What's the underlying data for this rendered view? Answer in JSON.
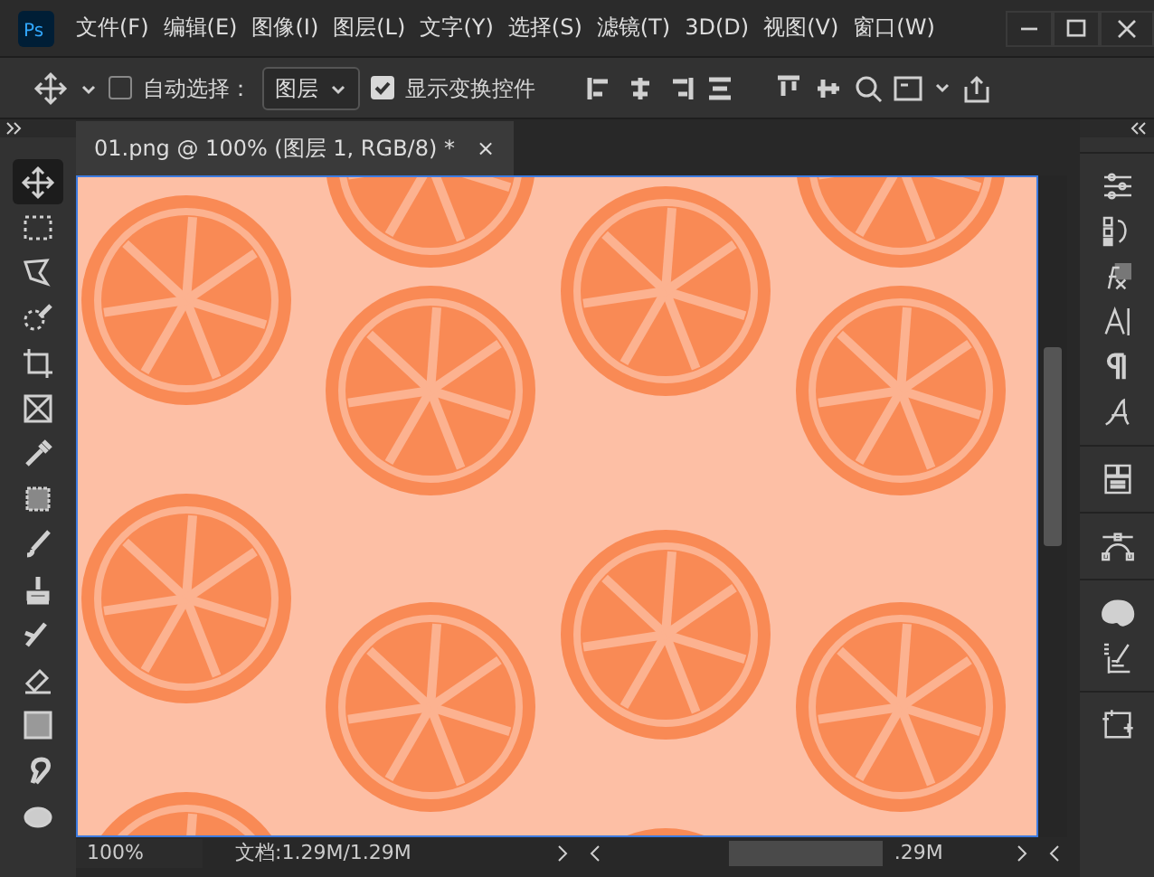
{
  "app_logo": "Ps",
  "menu": [
    "文件(F)",
    "编辑(E)",
    "图像(I)",
    "图层(L)",
    "文字(Y)",
    "选择(S)",
    "滤镜(T)",
    "3D(D)",
    "视图(V)",
    "窗口(W)"
  ],
  "options_bar": {
    "auto_select": {
      "label": "自动选择：",
      "checked": false
    },
    "target": {
      "value": "图层"
    },
    "show_transform": {
      "label": "显示变换控件",
      "checked": true
    }
  },
  "document_tab": {
    "title": "01.png @ 100% (图层 1, RGB/8) *",
    "close": "×"
  },
  "tools": [
    {
      "selected": true
    },
    {
      "selected": false
    },
    {
      "selected": false
    },
    {
      "selected": false
    },
    {
      "selected": false
    },
    {
      "selected": false
    },
    {
      "selected": false
    },
    {
      "selected": false
    },
    {
      "selected": false
    },
    {
      "selected": false
    },
    {
      "selected": false
    },
    {
      "selected": false
    },
    {
      "selected": false
    },
    {
      "selected": false
    },
    {
      "selected": false
    }
  ],
  "status_bar": {
    "zoom": "100%",
    "doc_size": "文档:1.29M/1.29M",
    "overlap_text": ".29M"
  }
}
